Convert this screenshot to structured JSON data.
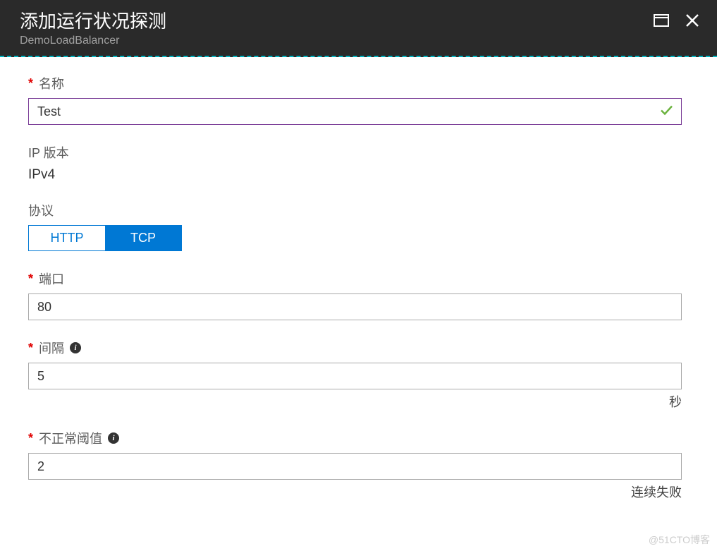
{
  "header": {
    "title": "添加运行状况探测",
    "subtitle": "DemoLoadBalancer"
  },
  "fields": {
    "name": {
      "label": "名称",
      "value": "Test"
    },
    "ipVersion": {
      "label": "IP 版本",
      "value": "IPv4"
    },
    "protocol": {
      "label": "协议",
      "options": {
        "http": "HTTP",
        "tcp": "TCP"
      }
    },
    "port": {
      "label": "端口",
      "value": "80"
    },
    "interval": {
      "label": "间隔",
      "value": "5",
      "suffix": "秒"
    },
    "unhealthyThreshold": {
      "label": "不正常阈值",
      "value": "2",
      "suffix": "连续失败"
    }
  },
  "watermark": "@51CTO博客"
}
